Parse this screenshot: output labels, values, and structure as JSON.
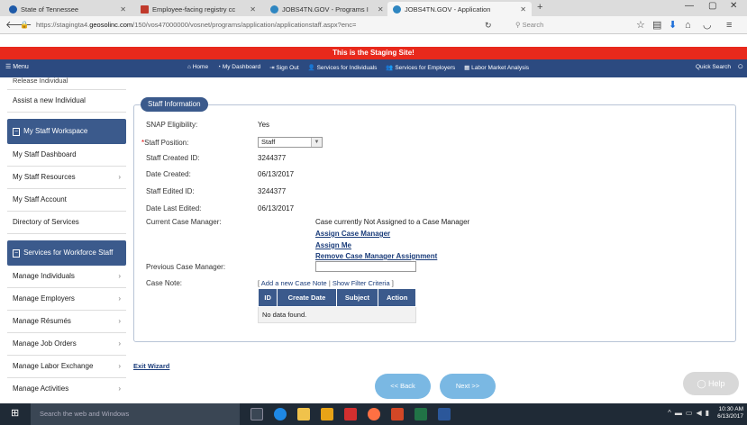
{
  "browser": {
    "tabs": [
      {
        "label": "State of Tennessee",
        "favicon_color": "#1e5aa8"
      },
      {
        "label": "Employee-facing registry cc",
        "favicon_color": "#c0392b"
      },
      {
        "label": "JOBS4TN.GOV - Programs I",
        "favicon_color": "#2e86c1"
      },
      {
        "label": "JOBS4TN.GOV - Application",
        "favicon_color": "#2e86c1"
      }
    ],
    "url_prefix": "https://stagingta4.",
    "url_domain": "geosolinc.com",
    "url_path": "/150/vos47000000/vosnet/programs/application/applicationstaff.aspx?enc=",
    "search_placeholder": "Search"
  },
  "site": {
    "staging_banner": "This is the Staging Site!",
    "menu_label": "Menu",
    "nav_links": [
      "Home",
      "My Dashboard",
      "Sign Out",
      "Services for Individuals",
      "Services for Employers",
      "Labor Market Analysis"
    ],
    "quick_search": "Quick Search"
  },
  "sidebar": {
    "cut_item": "Release Individual",
    "top_items": [
      {
        "label": "Assist a new Individual",
        "caret": false
      }
    ],
    "section1": "My Staff Workspace",
    "section1_items": [
      {
        "label": "My Staff Dashboard",
        "caret": false
      },
      {
        "label": "My Staff Resources",
        "caret": true
      },
      {
        "label": "My Staff Account",
        "caret": false
      },
      {
        "label": "Directory of Services",
        "caret": false
      }
    ],
    "section2": "Services for Workforce Staff",
    "section2_items": [
      {
        "label": "Manage Individuals",
        "caret": true
      },
      {
        "label": "Manage Employers",
        "caret": true
      },
      {
        "label": "Manage Résumés",
        "caret": true
      },
      {
        "label": "Manage Job Orders",
        "caret": true
      },
      {
        "label": "Manage Labor Exchange",
        "caret": true
      },
      {
        "label": "Manage Activities",
        "caret": true
      }
    ]
  },
  "staff_info": {
    "title": "Staff Information",
    "snap_label": "SNAP Eligibility:",
    "snap_value": "Yes",
    "position_label": "Staff Position:",
    "position_value": "Staff",
    "created_id_label": "Staff Created ID:",
    "created_id_value": "3244377",
    "date_created_label": "Date Created:",
    "date_created_value": "06/13/2017",
    "edited_id_label": "Staff Edited ID:",
    "edited_id_value": "3244377",
    "date_edited_label": "Date Last Edited:",
    "date_edited_value": "06/13/2017",
    "case_manager_label": "Current Case Manager:",
    "case_manager_value": "Case currently Not Assigned to a Case Manager",
    "assign_case_manager": "Assign Case Manager",
    "assign_me": "Assign Me",
    "remove_assignment": "Remove Case Manager Assignment",
    "prev_case_manager_label": "Previous Case Manager:",
    "case_note_label": "Case Note:",
    "add_case_note": "Add a new Case Note",
    "show_filter": "Show Filter Criteria",
    "table_headers": [
      "ID",
      "Create Date",
      "Subject",
      "Action"
    ],
    "empty_text": "No data found."
  },
  "footer": {
    "exit_wizard": "Exit Wizard",
    "back": "<< Back",
    "next": "Next >>",
    "help": "Help"
  },
  "taskbar": {
    "search_placeholder": "Search the web and Windows",
    "time": "10:30 AM",
    "date": "6/13/2017"
  }
}
